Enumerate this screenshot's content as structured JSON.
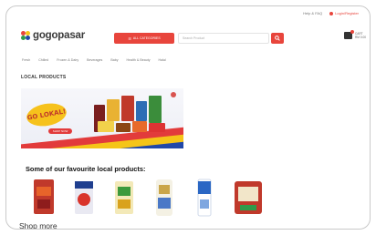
{
  "header": {
    "top_links": [
      "Help & FAQ",
      "Login/Register"
    ],
    "logo_text": "gogopasar",
    "category_button": "ALL CATEGORIES",
    "search_placeholder": "Search Product",
    "cart_label_line1": "CART",
    "cart_label_line2": "RM 0.00"
  },
  "nav": {
    "items": [
      "Fresh",
      "Chilled",
      "Frozen & Dairy",
      "Beverages",
      "Baby",
      "Health & Beauty",
      "Halal"
    ]
  },
  "section": {
    "title": "LOCAL PRODUCTS"
  },
  "banner": {
    "headline": "GO LOKAL!",
    "button": "SHOP NOW"
  },
  "favourites": {
    "title": "Some of our favourite local products:"
  },
  "shop_more": "Shop more",
  "colors": {
    "accent": "#e8453c",
    "brand_green": "#2e9b4a",
    "brand_red": "#e23b3b",
    "brand_yellow": "#f5c518",
    "brand_blue": "#2148a8"
  }
}
